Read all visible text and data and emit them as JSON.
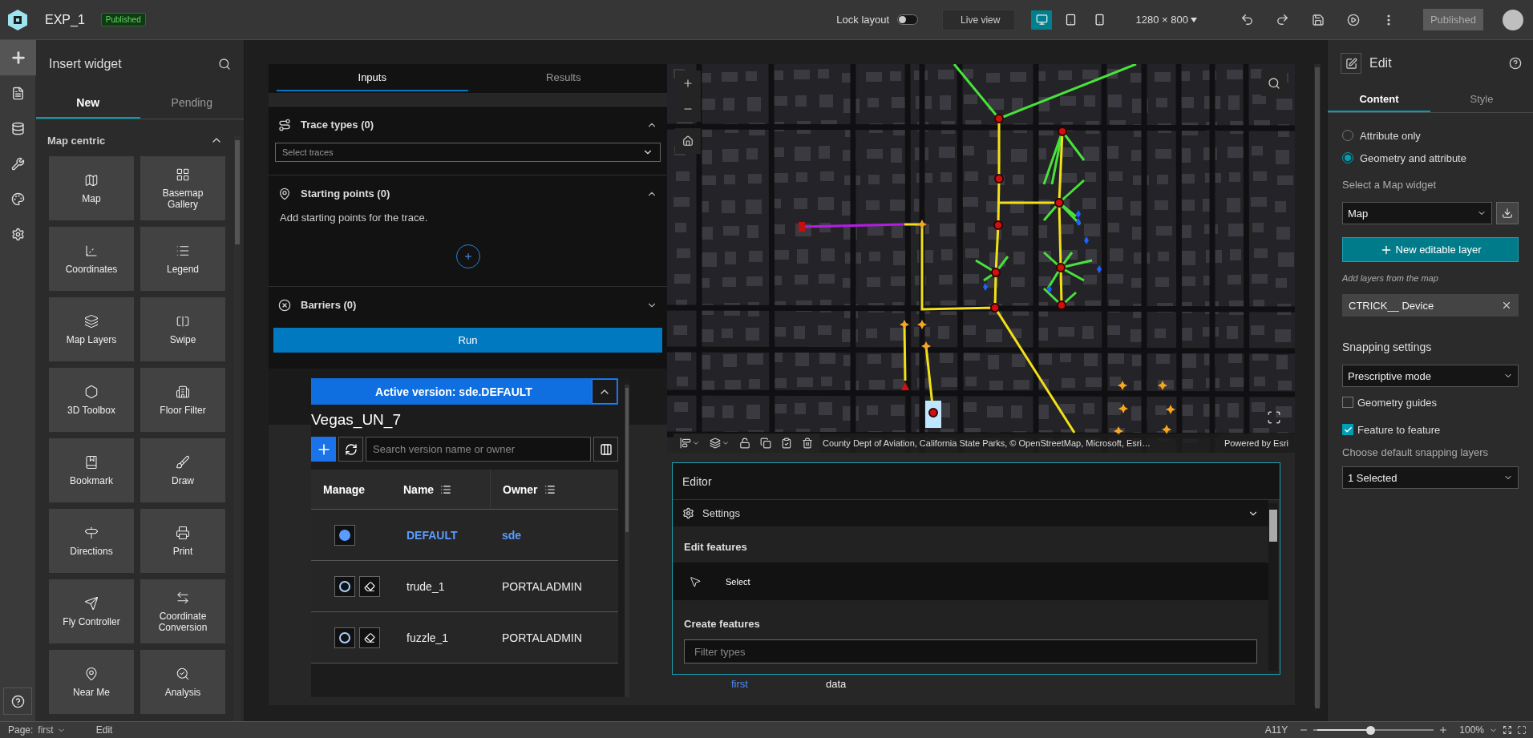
{
  "app": {
    "title": "EXP_1",
    "badge": "Published"
  },
  "toolbar": {
    "lock_layout": {
      "label": "Lock layout",
      "on": false
    },
    "live_view": "Live view",
    "devices": [
      {
        "kind": "desktop",
        "selected": true
      },
      {
        "kind": "tablet",
        "selected": false
      },
      {
        "kind": "phone",
        "selected": false
      }
    ],
    "resolution": "1280 × 800",
    "publish_button": "Published"
  },
  "rail": [
    {
      "kind": "insert",
      "selected": true
    },
    {
      "kind": "page",
      "selected": false
    },
    {
      "kind": "data",
      "selected": false
    },
    {
      "kind": "tools",
      "selected": false
    },
    {
      "kind": "theme",
      "selected": false
    },
    {
      "kind": "settings",
      "selected": false
    }
  ],
  "insert_panel": {
    "title": "Insert widget",
    "tabs": [
      {
        "label": "New",
        "selected": true
      },
      {
        "label": "Pending",
        "selected": false
      }
    ],
    "group": {
      "title": "Map centric",
      "expanded": true
    },
    "widgets": [
      {
        "label": "Map",
        "kind": "map"
      },
      {
        "label": "Basemap Gallery",
        "kind": "gallery"
      },
      {
        "label": "Coordinates",
        "kind": "coordinates"
      },
      {
        "label": "Legend",
        "kind": "legend"
      },
      {
        "label": "Map Layers",
        "kind": "layers"
      },
      {
        "label": "Swipe",
        "kind": "swipe"
      },
      {
        "label": "3D Toolbox",
        "kind": "toolbox"
      },
      {
        "label": "Floor Filter",
        "kind": "floor"
      },
      {
        "label": "Bookmark",
        "kind": "bookmark"
      },
      {
        "label": "Draw",
        "kind": "draw"
      },
      {
        "label": "Directions",
        "kind": "directions"
      },
      {
        "label": "Print",
        "kind": "print"
      },
      {
        "label": "Fly Controller",
        "kind": "fly"
      },
      {
        "label": "Coordinate Conversion",
        "kind": "conversion"
      },
      {
        "label": "Near Me",
        "kind": "nearme"
      },
      {
        "label": "Analysis",
        "kind": "analysis"
      }
    ]
  },
  "trace": {
    "tabs": [
      {
        "label": "Inputs",
        "selected": true
      },
      {
        "label": "Results",
        "selected": false
      }
    ],
    "sections": [
      {
        "kind": "trace_types",
        "title": "Trace types (0)",
        "expanded": true,
        "placeholder": "Select traces"
      },
      {
        "kind": "starting_points",
        "title": "Starting points (0)",
        "expanded": true,
        "hint": "Add starting points for the trace."
      },
      {
        "kind": "barriers",
        "title": "Barriers (0)",
        "expanded": false
      }
    ],
    "run_button": "Run"
  },
  "versions": {
    "banner": "Active version: sde.DEFAULT",
    "expanded": true,
    "title": "Vegas_UN_7",
    "search_placeholder": "Search version name or owner",
    "columns": [
      "Manage",
      "Name",
      "Owner"
    ],
    "rows": [
      {
        "name": "DEFAULT",
        "owner": "sde",
        "selected": true
      },
      {
        "name": "trude_1",
        "owner": "PORTALADMIN",
        "selected": false
      },
      {
        "name": "fuzzle_1",
        "owner": "PORTALADMIN",
        "selected": false
      }
    ]
  },
  "map": {
    "attribution": "County Dept of Aviation, California State Parks, © OpenStreetMap, Microsoft, Esri…",
    "powered_by": "Powered by Esri"
  },
  "editor": {
    "title": "Editor",
    "settings": {
      "label": "Settings",
      "expanded": false
    },
    "edit_heading": "Edit features",
    "tools": [
      {
        "label": "Select"
      }
    ],
    "create_heading": "Create features",
    "filter_placeholder": "Filter types"
  },
  "page_links": [
    {
      "label": "first",
      "selected": true
    },
    {
      "label": "data",
      "selected": false
    }
  ],
  "settings_panel": {
    "title": "Edit",
    "tabs": [
      {
        "label": "Content",
        "selected": true
      },
      {
        "label": "Style",
        "selected": false
      }
    ],
    "modes": [
      {
        "label": "Attribute only",
        "selected": false
      },
      {
        "label": "Geometry and attribute",
        "selected": true
      }
    ],
    "map_widget_label": "Select a Map widget",
    "map_widget": "Map",
    "new_layer_button": "New editable layer",
    "layers_hint": "Add layers from the map",
    "layers": [
      "CTRICK__ Device"
    ],
    "snapping_title": "Snapping settings",
    "snapping_mode": "Prescriptive mode",
    "options": [
      {
        "label": "Geometry guides",
        "checked": false
      },
      {
        "label": "Feature to feature",
        "checked": true
      }
    ],
    "snapping_layers_label": "Choose default snapping layers",
    "snapping_layers": "1 Selected"
  },
  "status_bar": {
    "page_label": "Page:",
    "page": "first",
    "mode": "Edit",
    "a11y": "A11Y",
    "zoom": {
      "level": 0.47,
      "reading": "100%"
    }
  }
}
